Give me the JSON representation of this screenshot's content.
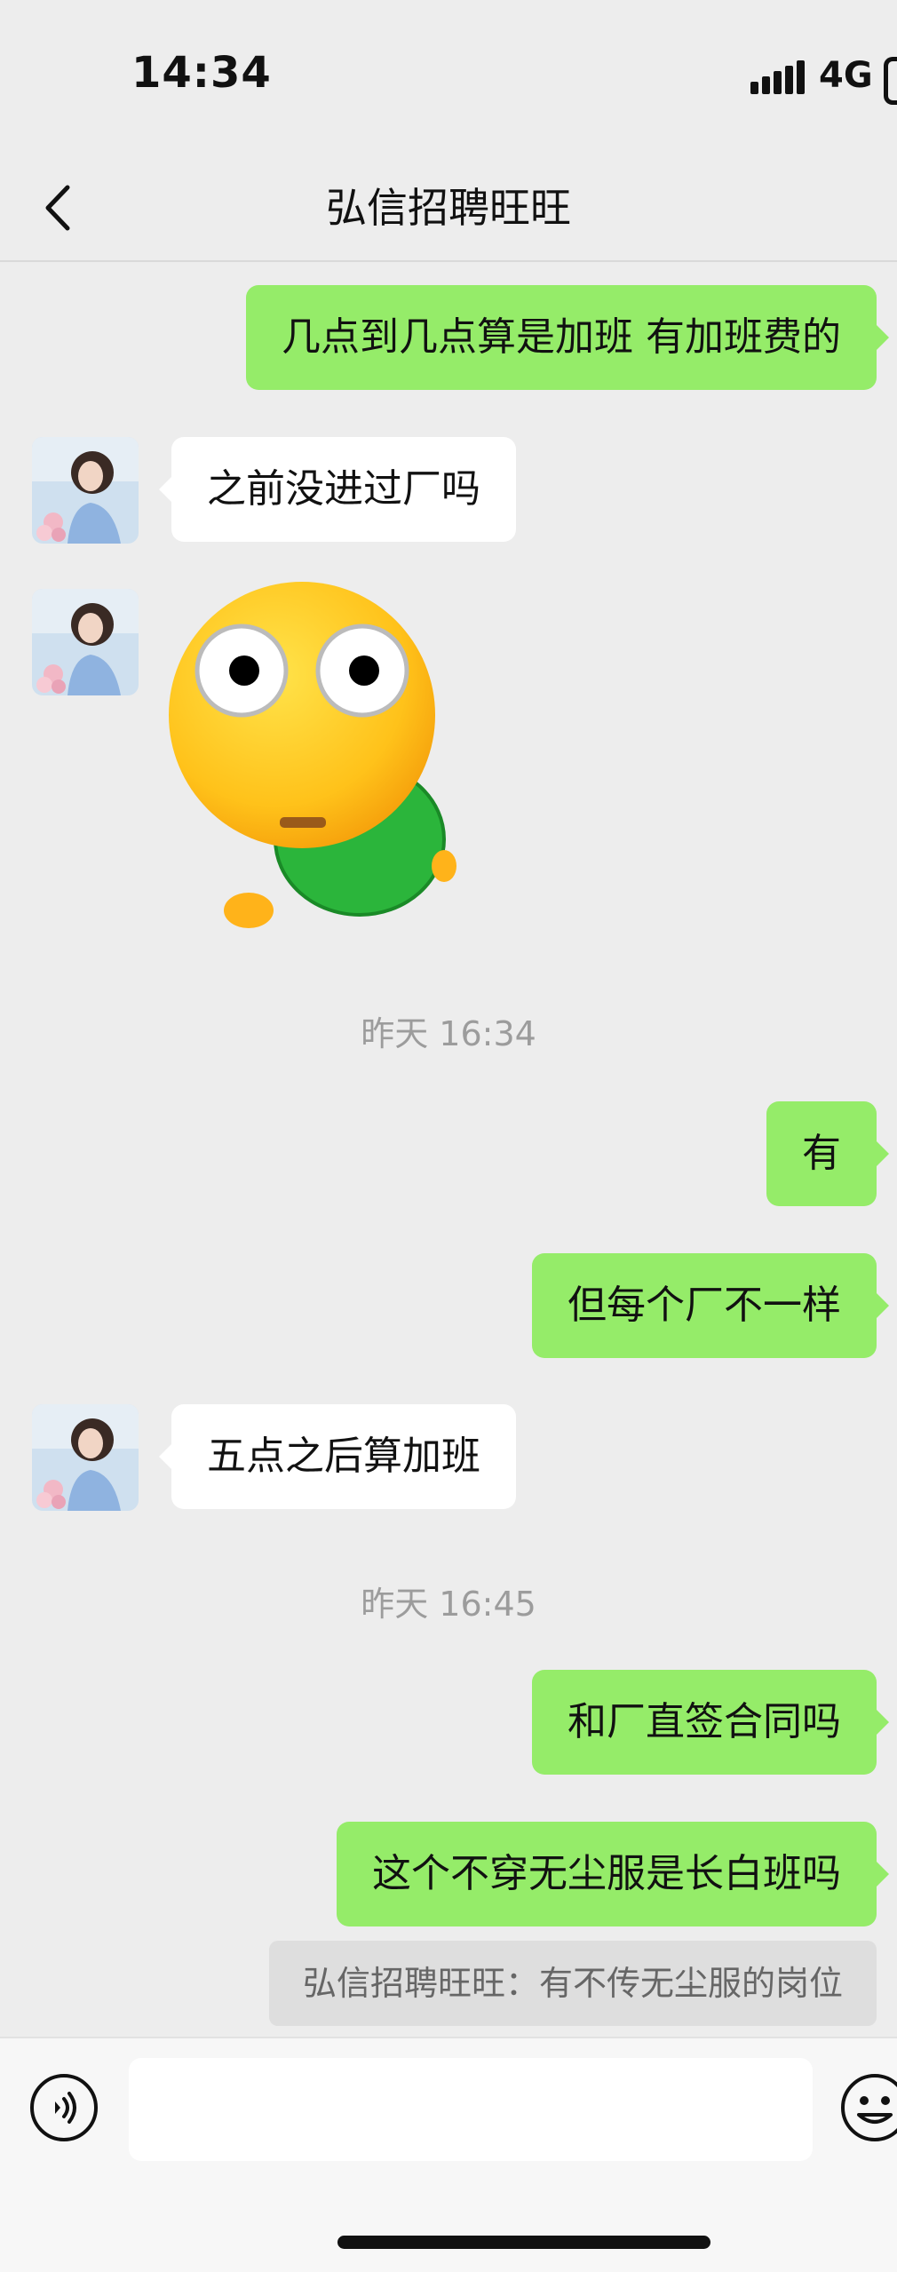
{
  "status_bar": {
    "time": "14:34",
    "network": "4G"
  },
  "header": {
    "title": "弘信招聘旺旺"
  },
  "messages": [
    {
      "type": "outgoing",
      "text": "几点到几点算是加班 有加班费的"
    },
    {
      "type": "incoming",
      "text": "之前没进过厂吗"
    },
    {
      "type": "incoming-sticker",
      "sticker": "wide-eyed-emoji-sticker"
    },
    {
      "type": "timestamp",
      "text": "昨天 16:34"
    },
    {
      "type": "outgoing",
      "text": "有"
    },
    {
      "type": "outgoing",
      "text": "但每个厂不一样"
    },
    {
      "type": "incoming",
      "text": "五点之后算加班"
    },
    {
      "type": "timestamp",
      "text": "昨天 16:45"
    },
    {
      "type": "outgoing",
      "text": "和厂直签合同吗"
    },
    {
      "type": "outgoing",
      "text": "这个不穿无尘服是长白班吗"
    },
    {
      "type": "quote",
      "text": "弘信招聘旺旺：有不传无尘服的岗位"
    }
  ],
  "input_bar": {
    "voice_icon": "voice-icon",
    "emoji_icon": "emoji-icon",
    "input_value": ""
  },
  "colors": {
    "outgoing_bubble": "#95ec69",
    "incoming_bubble": "#ffffff",
    "background": "#ededed"
  }
}
